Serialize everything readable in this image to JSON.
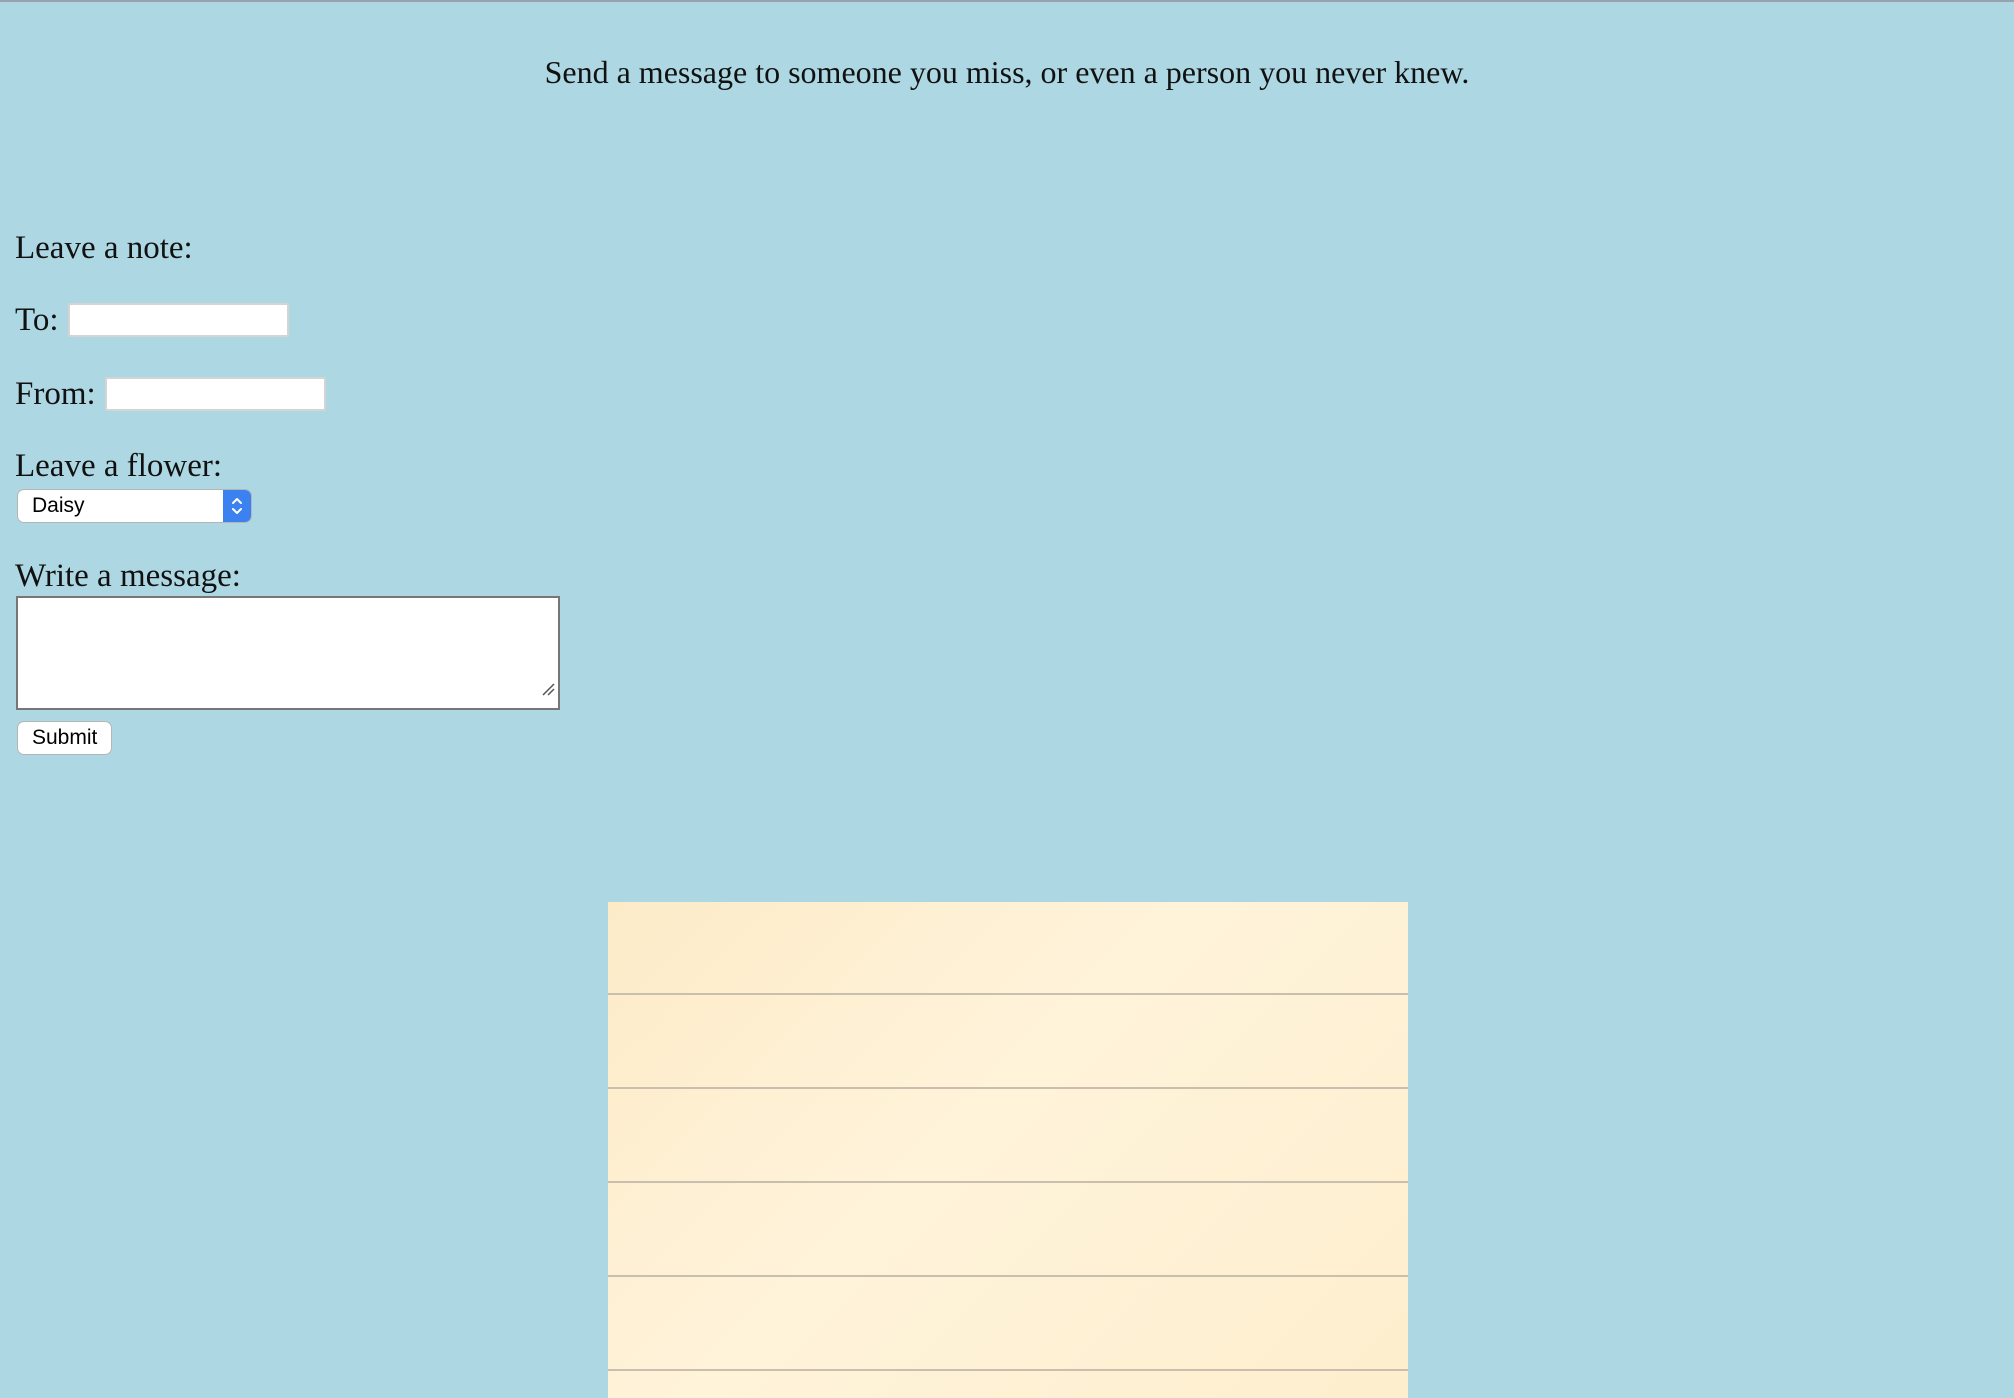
{
  "page": {
    "tagline": "Send a message to someone you miss, or even a person you never knew."
  },
  "form": {
    "heading": "Leave a note:",
    "to_label": "To:",
    "to_value": "",
    "from_label": "From:",
    "from_value": "",
    "flower_label": "Leave a flower:",
    "flower_selected": "Daisy",
    "message_label": "Write a message:",
    "message_value": "",
    "submit_label": "Submit"
  },
  "colors": {
    "background": "#add8e3",
    "paper": "#fff1d6",
    "select_accent": "#3b82f0"
  },
  "icons": {
    "select_indicator": "chevron-up-down-icon",
    "resize_handle": "resize-grip-icon"
  }
}
